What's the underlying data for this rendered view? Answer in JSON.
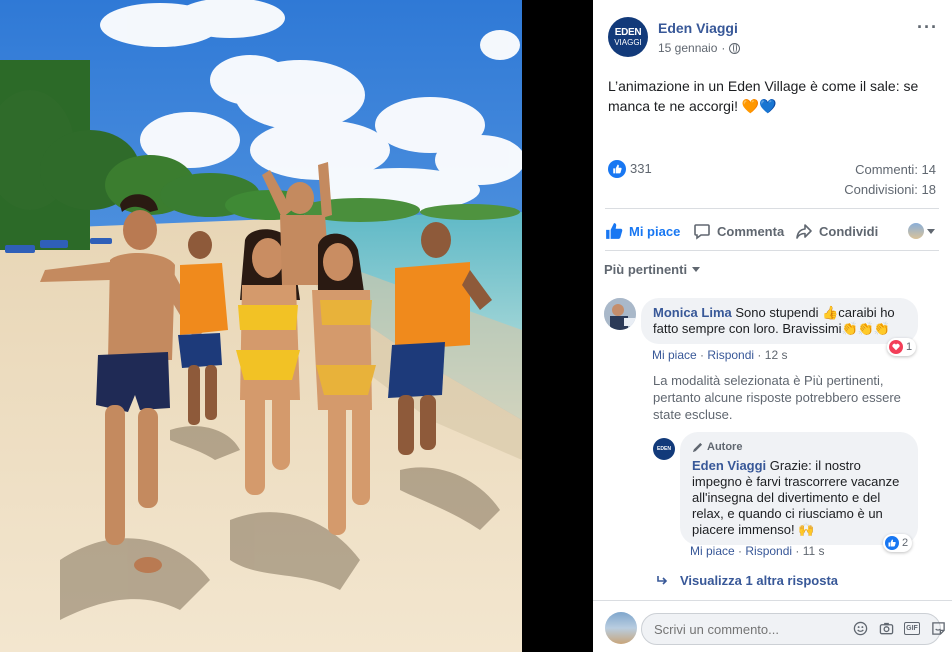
{
  "post": {
    "page_name": "Eden Viaggi",
    "avatar_line1": "EDEN",
    "avatar_line2": "VIAGGI",
    "date": "15 gennaio",
    "date_separator": "·",
    "text": "L’animazione in un Eden Village è come il sale: se manca te ne accorgi! 🧡💙",
    "likes": "331",
    "comments_label": "Commenti: 14",
    "shares_label": "Condivisioni: 18"
  },
  "actions": {
    "like": "Mi piace",
    "comment": "Commenta",
    "share": "Condividi"
  },
  "sort_label": "Più pertinenti",
  "comments": [
    {
      "author": "Monica Lima",
      "text": "Sono stupendi 👍caraibi ho fatto sempre con loro. Bravissimi👏👏👏",
      "like_label": "Mi piace",
      "reply_label": "Rispondi",
      "time": "12 s",
      "reaction_count": "1",
      "separator": "·"
    }
  ],
  "filter_note": "La modalità selezionata è Più pertinenti, pertanto alcune risposte potrebbero essere state escluse.",
  "reply": {
    "badge": "Autore",
    "author": "Eden Viaggi",
    "text": "Grazie: il nostro impegno è farvi trascorrere vacanze all'insegna del divertimento e del relax, e quando ci riusciamo è un piacere immenso! 🙌",
    "like_label": "Mi piace",
    "reply_label": "Rispondi",
    "time": "11 s",
    "reaction_count": "2",
    "separator": "·"
  },
  "view_more": "Visualizza 1 altra risposta",
  "composer": {
    "placeholder": "Scrivi un commento...",
    "gif_label": "GIF"
  },
  "colors": {
    "link_blue": "#385898",
    "fb_blue": "#1877f2",
    "heart_red": "#f33e58",
    "bubble_bg": "#f0f2f5",
    "text_gray": "#606770"
  },
  "icons": [
    "more-icon",
    "globe-icon",
    "like-icon",
    "comment-icon",
    "share-icon",
    "reply-arrow-icon",
    "emoji-icon",
    "camera-icon",
    "gif-icon",
    "sticker-icon"
  ]
}
